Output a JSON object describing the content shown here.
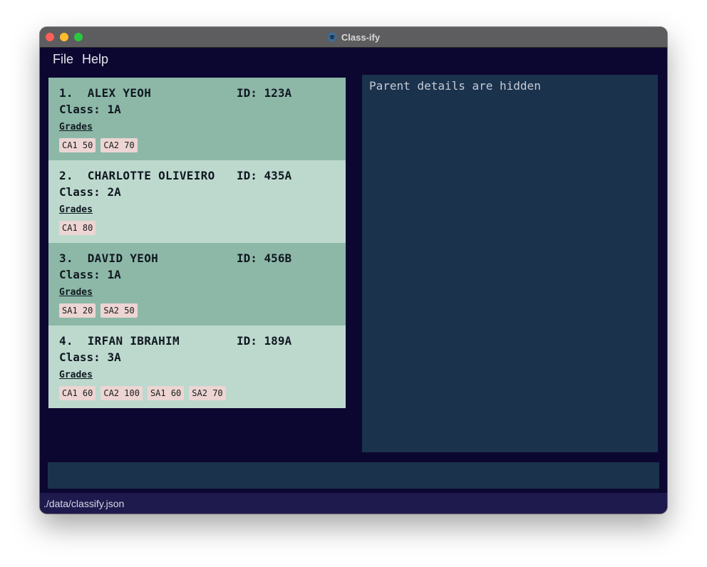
{
  "window": {
    "title": "Class-ify"
  },
  "menu": {
    "file_label": "File",
    "help_label": "Help"
  },
  "students": [
    {
      "index": "1.",
      "name": "ALEX YEOH",
      "id_label": "ID:",
      "id": "123A",
      "class_label": "Class:",
      "class": "1A",
      "grades_label": "Grades",
      "grades": [
        "CA1 50",
        "CA2 70"
      ]
    },
    {
      "index": "2.",
      "name": "CHARLOTTE OLIVEIRO",
      "id_label": "ID:",
      "id": "435A",
      "class_label": "Class:",
      "class": "2A",
      "grades_label": "Grades",
      "grades": [
        "CA1 80"
      ]
    },
    {
      "index": "3.",
      "name": "DAVID YEOH",
      "id_label": "ID:",
      "id": "456B",
      "class_label": "Class:",
      "class": "1A",
      "grades_label": "Grades",
      "grades": [
        "SA1 20",
        "SA2 50"
      ]
    },
    {
      "index": "4.",
      "name": "IRFAN IBRAHIM",
      "id_label": "ID:",
      "id": "189A",
      "class_label": "Class:",
      "class": "3A",
      "grades_label": "Grades",
      "grades": [
        "CA1 60",
        "CA2 100",
        "SA1 60",
        "SA2 70"
      ]
    }
  ],
  "detail": {
    "message": "Parent details are hidden"
  },
  "command": {
    "value": ""
  },
  "status": {
    "path": "./data/classify.json"
  },
  "colors": {
    "background": "#0c0730",
    "card_dark": "#8db8a8",
    "card_light": "#bdd9ce",
    "panel": "#1b324d",
    "tag": "#ecd5d3",
    "status_bar": "#1e1a4d"
  }
}
